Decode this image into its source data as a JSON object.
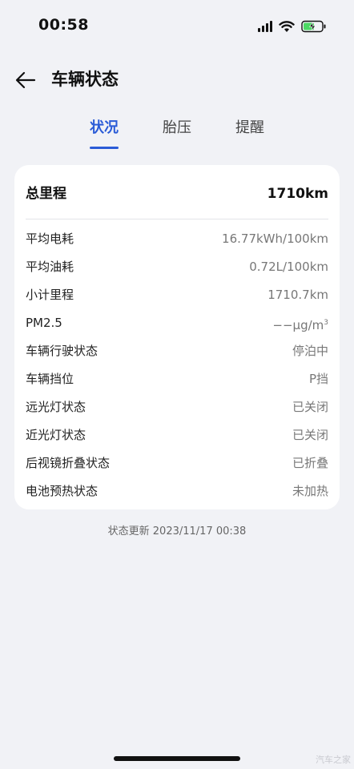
{
  "status_bar": {
    "time": "00:58"
  },
  "header": {
    "title": "车辆状态",
    "back_icon": "arrow-left-icon"
  },
  "tabs": [
    {
      "label": "状况",
      "active": true
    },
    {
      "label": "胎压",
      "active": false
    },
    {
      "label": "提醒",
      "active": false
    }
  ],
  "summary": {
    "label": "总里程",
    "value": "1710km"
  },
  "details": [
    {
      "label": "平均电耗",
      "value": "16.77kWh/100km"
    },
    {
      "label": "平均油耗",
      "value": "0.72L/100km"
    },
    {
      "label": "小计里程",
      "value": "1710.7km"
    },
    {
      "label": "PM2.5",
      "value": "−−μg/m",
      "sup": "3"
    },
    {
      "label": "车辆行驶状态",
      "value": "停泊中"
    },
    {
      "label": "车辆挡位",
      "value": "P挡"
    },
    {
      "label": "远光灯状态",
      "value": "已关闭"
    },
    {
      "label": "近光灯状态",
      "value": "已关闭"
    },
    {
      "label": "后视镜折叠状态",
      "value": "已折叠"
    },
    {
      "label": "电池预热状态",
      "value": "未加热"
    }
  ],
  "update_time": "状态更新 2023/11/17 00:38",
  "watermark": "汽车之家",
  "colors": {
    "accent": "#2a5bd7",
    "background": "#f1f2f6",
    "card": "#ffffff"
  }
}
